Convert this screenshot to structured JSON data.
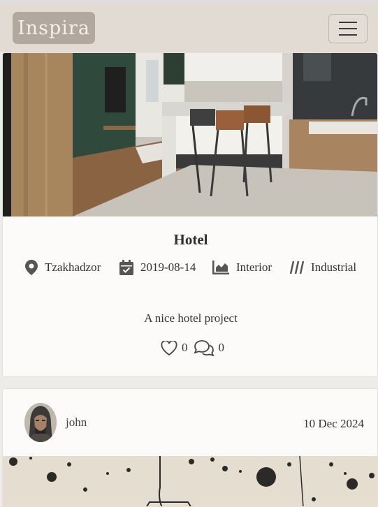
{
  "brand": {
    "logo_text": "Inspira"
  },
  "nav": {
    "menu_icon": "hamburger-icon"
  },
  "project": {
    "title": "Hotel",
    "location": "Tzakhadzor",
    "date": "2019-08-14",
    "category": "Interior",
    "style": "Industrial",
    "description": "A nice hotel project",
    "likes": "0",
    "comments": "0"
  },
  "post": {
    "username": "john",
    "date": "10 Dec 2024"
  },
  "icons": {
    "location": "map-pin-icon",
    "date": "calendar-check-icon",
    "category": "area-chart-icon",
    "style": "diagonal-lines-icon",
    "likes": "heart-icon",
    "comments": "chat-bubbles-icon"
  }
}
